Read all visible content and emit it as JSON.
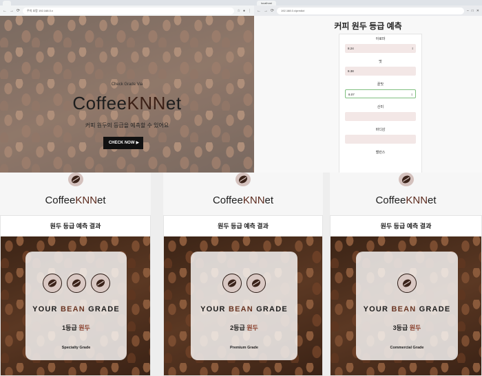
{
  "browser_left": {
    "tab_title": "",
    "address": "192.168.0.x",
    "address_label": "주의 요함"
  },
  "browser_right": {
    "tab_title": "localhost",
    "address": "192.168.0.x/predict"
  },
  "hero": {
    "small": "Check Grade Via",
    "logo_main": "Coffee",
    "logo_accent": "KNN",
    "logo_end": "et",
    "subtitle": "커피 원두의 등급을 예측할 수 있어요",
    "button": "CHECK NOW",
    "button_icon": "▶"
  },
  "form": {
    "title": "커피 원두 등급 예측",
    "fields": [
      {
        "label": "아로마",
        "value": "8.24"
      },
      {
        "label": "맛",
        "value": "8.38"
      },
      {
        "label": "끝맛",
        "value": "8.07"
      },
      {
        "label": "산미",
        "value": ""
      },
      {
        "label": "바디감",
        "value": ""
      },
      {
        "label": "밸런스",
        "value": ""
      }
    ]
  },
  "results": [
    {
      "brand_main": "Coffee",
      "brand_accent": "KNN",
      "brand_end": "et",
      "title": "원두 등급 예측 결과",
      "heading_a": "YOUR ",
      "heading_b": "BEAN",
      "heading_c": " GRADE",
      "grade_a": "1등급 ",
      "grade_b": "원두",
      "type": "Specialty Grade",
      "beans": 3
    },
    {
      "brand_main": "Coffee",
      "brand_accent": "KNN",
      "brand_end": "et",
      "title": "원두 등급 예측 결과",
      "heading_a": "YOUR ",
      "heading_b": "BEAN",
      "heading_c": " GRADE",
      "grade_a": "2등급 ",
      "grade_b": "원두",
      "type": "Premium Grade",
      "beans": 2
    },
    {
      "brand_main": "Coffee",
      "brand_accent": "KNN",
      "brand_end": "et",
      "title": "원두 등급 예측 결과",
      "heading_a": "YOUR ",
      "heading_b": "BEAN",
      "heading_c": " GRADE",
      "grade_a": "3등급 ",
      "grade_b": "원두",
      "type": "Commercial Grade",
      "beans": 1
    }
  ]
}
